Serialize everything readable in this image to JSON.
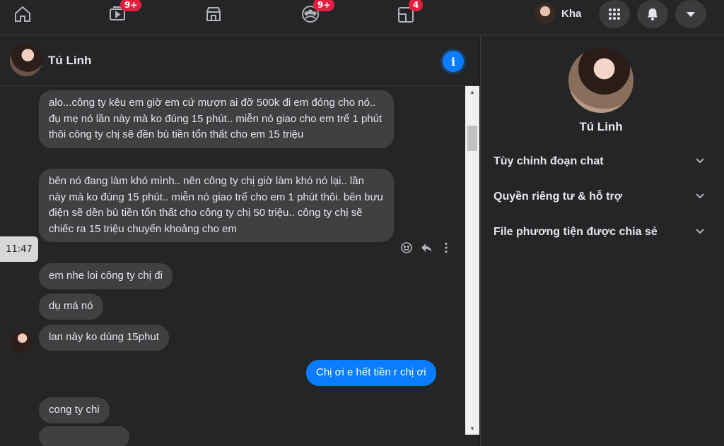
{
  "topbar": {
    "nav": [
      {
        "name": "home-icon",
        "badge": ""
      },
      {
        "name": "watch-icon",
        "badge": "9+"
      },
      {
        "name": "marketplace-icon",
        "badge": ""
      },
      {
        "name": "groups-icon",
        "badge": "9+"
      },
      {
        "name": "gaming-icon",
        "badge": "4"
      }
    ],
    "profile_name": "Kha",
    "menu_icon": "grid-menu-icon",
    "notifications_icon": "bell-icon",
    "account_icon": "caret-down-icon"
  },
  "chat": {
    "contact_name": "Tú Linh",
    "info_icon": "info-icon",
    "time_label": "11:47",
    "messages": [
      {
        "from": "them",
        "text": "alo...công ty kêu em giờ em cứ mượn ai đỡ 500k đi em đóng cho nó.. đụ mẹ nó lần này mà ko đúng 15 phút.. miễn nó giao cho em trể 1 phút thôi công ty chị sẽ đền bù tiền tổn thất cho em 15 triệu"
      },
      {
        "from": "them",
        "text": "bên nó đang làm khó mình.. nên công ty chị giờ làm khó nó lại.. lần này mà ko đúng 15 phút.. miễn nó giao trể cho em 1 phút thôi. bên bưu điện sẽ  dền bù tiền tổn thất cho công ty chị 50 triệu.. công ty chị sẽ chiếc ra 15 triệu chuyển khoảng cho em"
      },
      {
        "from": "them",
        "text": "em nhe loi công ty chị đi"
      },
      {
        "from": "them",
        "text": "dụ má nó"
      },
      {
        "from": "them",
        "text": "lan này ko dúng 15phut"
      },
      {
        "from": "me",
        "text": "Chị ơi e hết tiền r chị ơi"
      },
      {
        "from": "them",
        "text": "cong ty chi"
      }
    ]
  },
  "side": {
    "contact_name": "Tú Linh",
    "sections": [
      {
        "label": "Tùy chỉnh đoạn chat"
      },
      {
        "label": "Quyền riêng tư & hỗ trợ"
      },
      {
        "label": "File phương tiện được chia sẻ"
      }
    ]
  },
  "colors": {
    "accent": "#0a7cff",
    "badge": "#e41e3f",
    "bubble_them": "#3e4042",
    "background": "#242526"
  }
}
